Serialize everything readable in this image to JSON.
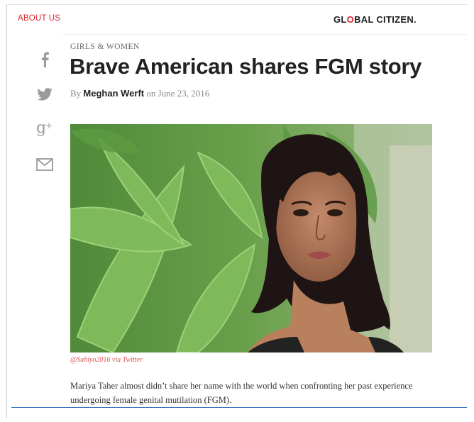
{
  "header": {
    "about_link": "ABOUT US",
    "logo_text_pre": "GL",
    "logo_text_o": "O",
    "logo_text_post": "BAL CITIZEN",
    "logo_dot": "."
  },
  "share": {
    "icons": [
      "facebook-icon",
      "twitter-icon",
      "google-plus-icon",
      "email-icon"
    ]
  },
  "article": {
    "category": "GIRLS & WOMEN",
    "title": "Brave American shares FGM story",
    "by_prefix": "By",
    "author": "Meghan Werft",
    "date_prefix": "on",
    "date": "June 23, 2016",
    "image_caption": "@Sahiyo2016 via Twitter",
    "lead_paragraph": "Mariya Taher almost didn’t share her name with the world when confronting her past experience undergoing female genital mutilation (FGM)."
  },
  "colors": {
    "brand_red": "#e0252e",
    "title_text": "#222222",
    "caption_red": "#d9534f",
    "divider_blue": "#2f6fb8"
  }
}
